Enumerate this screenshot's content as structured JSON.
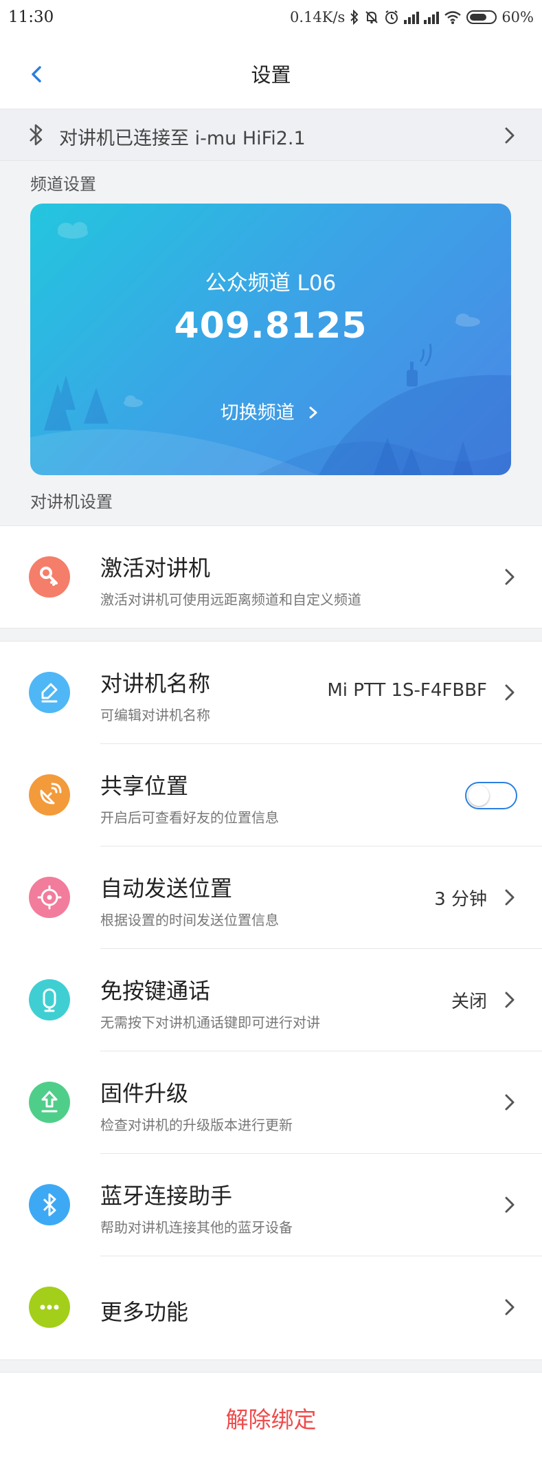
{
  "status_bar": {
    "time": "11:30",
    "net_speed": "0.14K/s",
    "battery": "60%",
    "icons": [
      "bluetooth-icon",
      "mute-bell-icon",
      "alarm-icon",
      "signal-icon",
      "signal-icon",
      "wifi-icon",
      "battery-icon"
    ]
  },
  "nav": {
    "title": "设置",
    "back_icon": "chevron-left-icon"
  },
  "bt_banner": {
    "text": "对讲机已连接至 i-mu HiFi2.1"
  },
  "channel": {
    "section_label": "频道设置",
    "name": "公众频道 L06",
    "frequency": "409.8125",
    "switch_label": "切换频道"
  },
  "device_section_label": "对讲机设置",
  "activate": {
    "title": "激活对讲机",
    "subtitle": "激活对讲机可使用远距离频道和自定义频道",
    "icon": "key-icon",
    "color": "#f47e6a"
  },
  "settings": {
    "name": {
      "title": "对讲机名称",
      "subtitle": "可编辑对讲机名称",
      "value": "Mi PTT 1S-F4FBBF",
      "icon": "edit-icon",
      "color": "#4fb7f5"
    },
    "share": {
      "title": "共享位置",
      "subtitle": "开启后可查看好友的位置信息",
      "toggle": false,
      "icon": "satellite-icon",
      "color": "#f39a3b"
    },
    "auto_send": {
      "title": "自动发送位置",
      "subtitle": "根据设置的时间发送位置信息",
      "value": "3 分钟",
      "icon": "target-icon",
      "color": "#f27c9c"
    },
    "handsfree": {
      "title": "免按键通话",
      "subtitle": "无需按下对讲机通话键即可进行对讲",
      "value": "关闭",
      "icon": "microphone-icon",
      "color": "#3fcfd3"
    },
    "firmware": {
      "title": "固件升级",
      "subtitle": "检查对讲机的升级版本进行更新",
      "icon": "upload-icon",
      "color": "#4fce8a"
    },
    "bt_helper": {
      "title": "蓝牙连接助手",
      "subtitle": "帮助对讲机连接其他的蓝牙设备",
      "icon": "bluetooth-icon",
      "color": "#3da9f5"
    },
    "more": {
      "title": "更多功能",
      "icon": "more-dots-icon",
      "color": "#a3cf1a"
    }
  },
  "unbind_label": "解除绑定"
}
